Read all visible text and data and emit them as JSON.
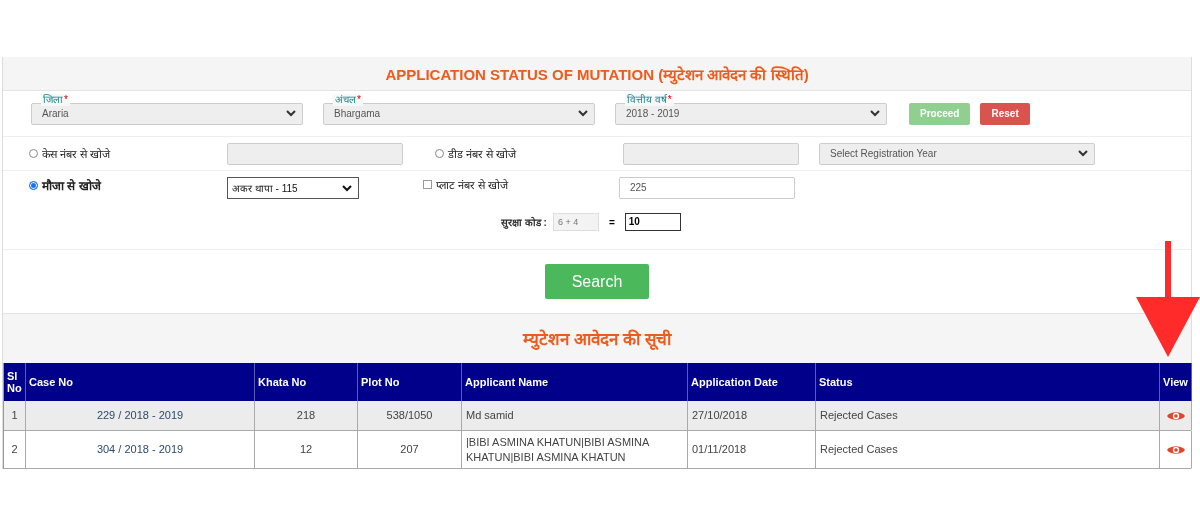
{
  "title": "APPLICATION STATUS OF MUTATION (म्युटेशन आवेदन की स्थिति)",
  "selects": [
    {
      "label": "जिला",
      "required_mark": "*",
      "value": "Araria"
    },
    {
      "label": "अंचल",
      "required_mark": "*",
      "value": "Bhargama"
    },
    {
      "label": "वित्तीय वर्ष",
      "required_mark": "*",
      "value": "2018 - 2019"
    }
  ],
  "buttons": [
    {
      "label": "Proceed",
      "kind": "proceed"
    },
    {
      "label": "Reset",
      "kind": "reset"
    }
  ],
  "search_options": [
    {
      "kind": "radio",
      "label": "केस नंबर से खोजे",
      "selected": false
    },
    {
      "kind": "radio",
      "label": "डीड नंबर से खोजे",
      "selected": false
    },
    {
      "kind": "radio",
      "label": "मौजा से खोजे",
      "selected": true,
      "select_value": "अकर थापा - 115"
    },
    {
      "kind": "checkbox",
      "label": "प्लाट नंबर से खोजे",
      "checked": false,
      "value": "225"
    }
  ],
  "registration_year": {
    "placeholder": "Select Registration Year"
  },
  "captcha": {
    "label": "सुरक्षा कोड :",
    "question": "6 + 4",
    "equals": "=",
    "answer": "10"
  },
  "search_button": "Search",
  "list_title": "म्युटेशन आवेदन की सूची",
  "table": {
    "columns": [
      "Sl No",
      "Case No",
      "Khata No",
      "Plot No",
      "Applicant Name",
      "Application Date",
      "Status",
      "View"
    ],
    "rows": [
      {
        "sl": "1",
        "case_no": "229 / 2018 - 2019",
        "khata_no": "218",
        "plot_no": "538/1050",
        "applicant": "Md samid",
        "date": "27/10/2018",
        "status": "Rejected Cases"
      },
      {
        "sl": "2",
        "case_no": "304 / 2018 - 2019",
        "khata_no": "12",
        "plot_no": "207",
        "applicant": "|BIBI ASMINA KHATUN|BIBI ASMINA KHATUN|BIBI ASMINA KHATUN",
        "date": "01/11/2018",
        "status": "Rejected Cases"
      }
    ]
  }
}
